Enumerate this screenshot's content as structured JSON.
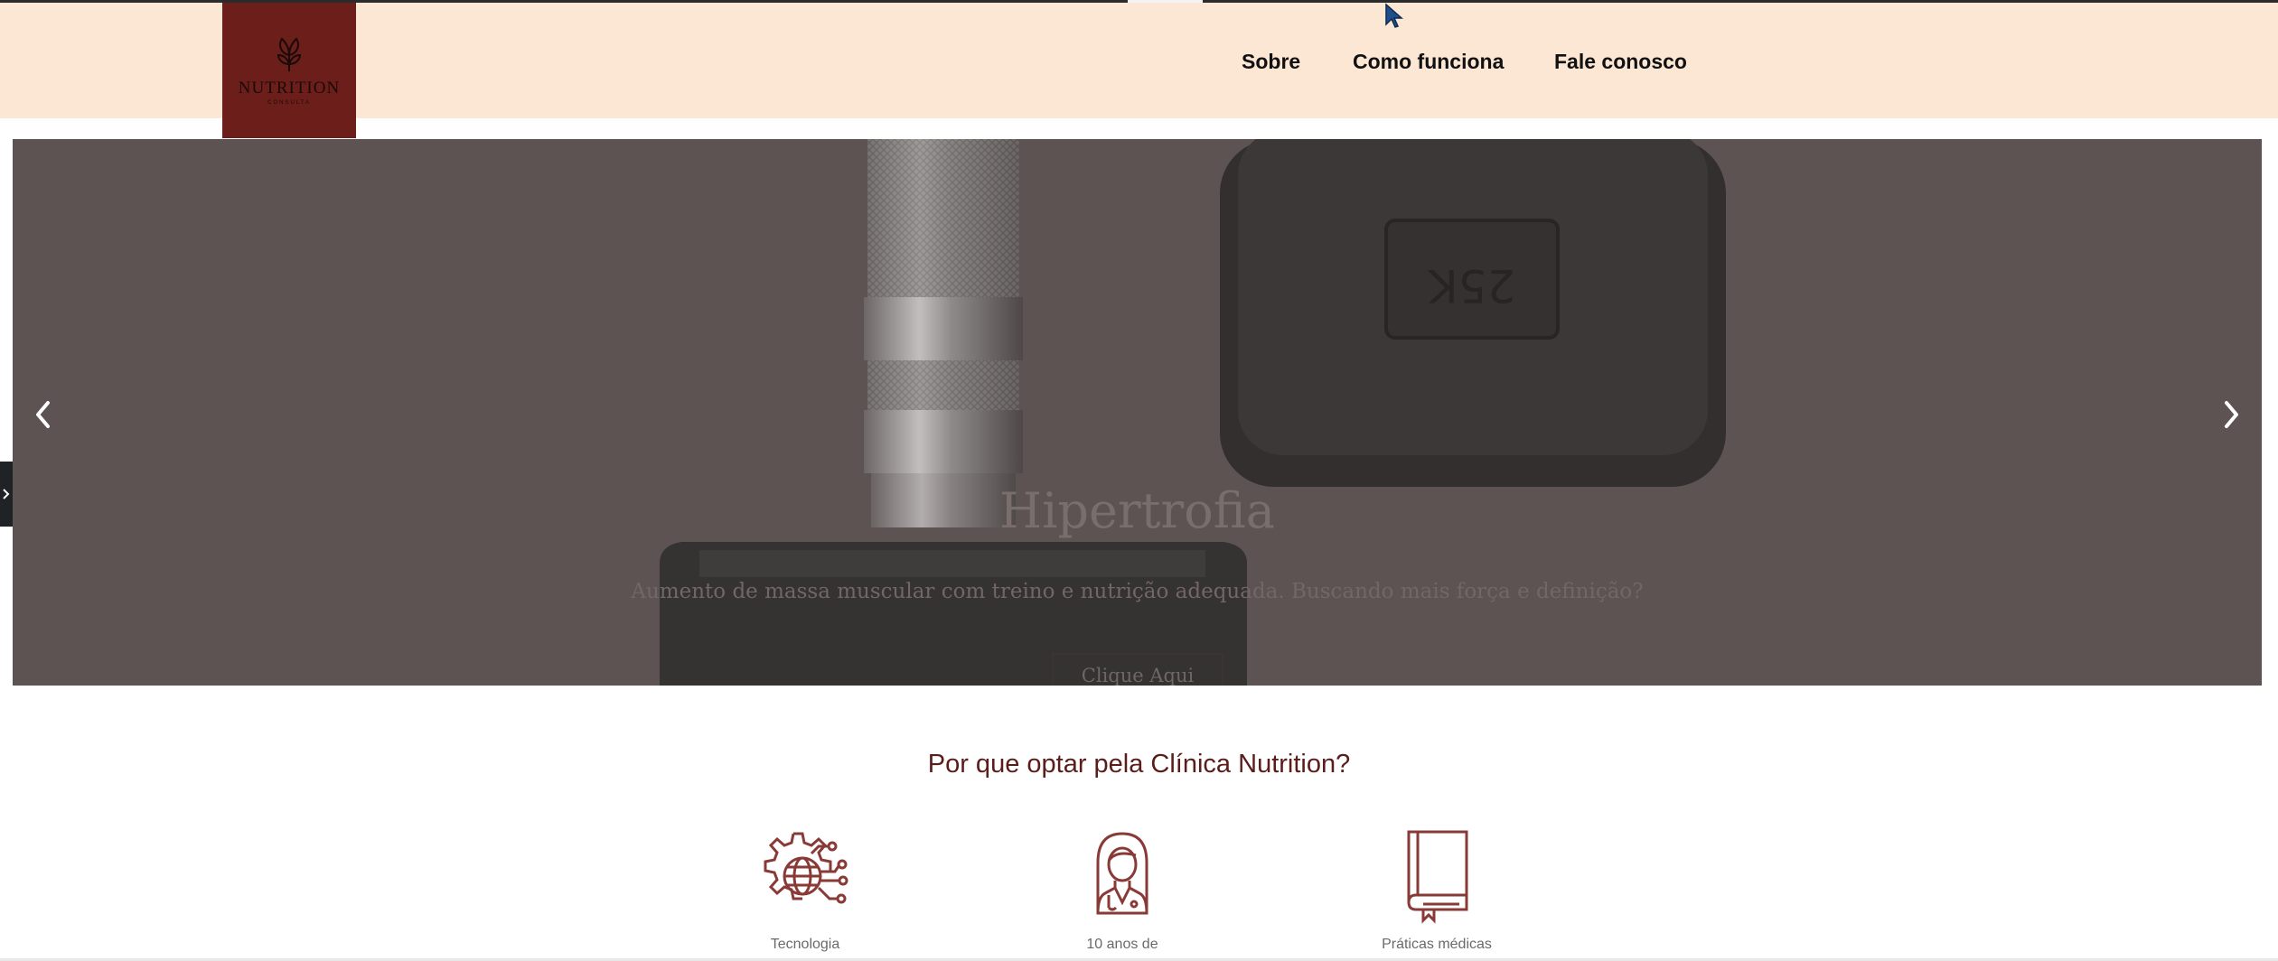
{
  "header": {
    "logo": {
      "name": "NUTRITION",
      "sub": "CONSULTA"
    },
    "nav": [
      {
        "label": "Sobre"
      },
      {
        "label": "Como funciona"
      },
      {
        "label": "Fale conosco"
      }
    ]
  },
  "carousel": {
    "title": "Hipertrofia",
    "description": "Aumento de massa muscular com treino e nutrição adequada. Buscando mais força e definição?",
    "cta": "Clique Aqui",
    "prev_icon": "chevron-left-icon",
    "next_icon": "chevron-right-icon"
  },
  "section": {
    "title": "Por que optar pela Clínica Nutrition?",
    "features": [
      {
        "label": "Tecnologia",
        "icon": "gear-globe-icon"
      },
      {
        "label": "10 anos de",
        "icon": "doctor-icon"
      },
      {
        "label": "Práticas médicas",
        "icon": "book-icon"
      }
    ]
  },
  "colors": {
    "header_bg": "#fce6d4",
    "logo_bg": "#6b1e1a",
    "accent": "#5a1d1a",
    "carousel_bg": "#5d5352"
  }
}
